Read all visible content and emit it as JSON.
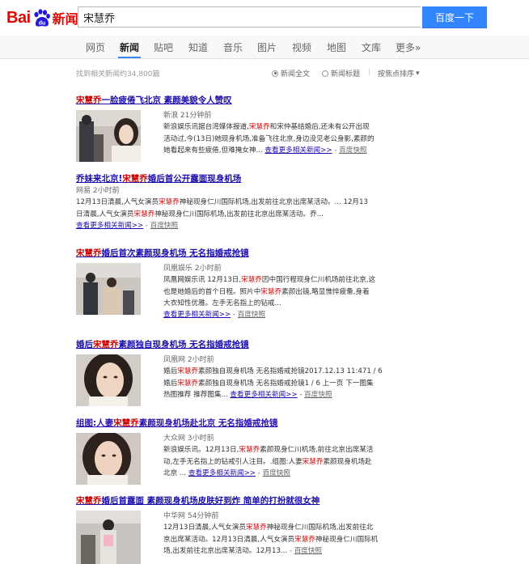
{
  "header": {
    "logo_bai": "Bai",
    "logo_du": "du",
    "logo_news": "新闻",
    "search_value": "宋慧乔",
    "search_button": "百度一下"
  },
  "tabs": [
    "网页",
    "新闻",
    "贴吧",
    "知道",
    "音乐",
    "图片",
    "视频",
    "地图",
    "文库",
    "更多»"
  ],
  "active_tab": "新闻",
  "infobar": {
    "count": "找到相关新闻约34,800篇",
    "opt_full": "新闻全文",
    "opt_title": "新闻标题",
    "sort": "按焦点排序",
    "sort_arrow": "▾"
  },
  "common": {
    "more": "查看更多相关新闻>>",
    "snapshot": "百度快照",
    "dash": "-"
  },
  "highlight": "宋慧乔",
  "results": [
    {
      "title_pre": "",
      "title_hl": "宋慧乔",
      "title_post": "一脸疲倦飞北京 素颜美貌令人赞叹",
      "source": "新浪  21分钟前",
      "lines": [
        [
          "新浪娱乐讯据台湾媒体报道,",
          "宋慧乔",
          "和宋仲基结婚后,还未有公开出现"
        ],
        [
          "活动过,今(13日)她现身机场,准备飞往北京,身边没见老公身影,素颜的",
          "",
          ""
        ],
        [
          "她看起来有些疲倦,但难掩女神...",
          "",
          ""
        ]
      ],
      "has_thumb": true
    },
    {
      "title_pre": "乔妹来北京!",
      "title_hl": "宋慧乔",
      "title_post": "婚后首公开露面现身机场",
      "source": "网易  2小时前",
      "lines": [
        [
          "12月13日清晨,人气女演员",
          "宋慧乔",
          "神秘现身仁川国际机场,出发前往北京出席某活动。... 12月13"
        ],
        [
          "日清晨,人气女演员",
          "宋慧乔",
          "神秘现身仁川国际机场,出发前往北京出席某活动。乔..."
        ]
      ],
      "has_thumb": false
    },
    {
      "title_pre": "",
      "title_hl": "宋慧乔",
      "title_post": "婚后首次素颜现身机场 无名指婚戒抢镜",
      "source": "凤凰娱乐  2小时前",
      "lines": [
        [
          "凤凰网娱乐讯 12月13日,",
          "宋慧乔",
          "因中国行程现身仁川机场前往北京,这"
        ],
        [
          "也是她婚后的首个日程。照片中",
          "宋慧乔",
          "素颜出镜,略显憔悴疲惫,身着"
        ],
        [
          "大衣知性优雅。左手无名指上的钻戒...",
          "",
          ""
        ]
      ],
      "has_thumb": true
    },
    {
      "title_pre": "婚后",
      "title_hl": "宋慧乔",
      "title_post": "素颜独自现身机场 无名指婚戒抢镜",
      "source": "凤凰网  2小时前",
      "lines": [
        [
          "婚后",
          "宋慧乔",
          "素颜独自现身机场 无名指婚戒抢镜2017.12.13 11:471 / 6"
        ],
        [
          "婚后",
          "宋慧乔",
          "素颜独自现身机场 无名指婚戒抢镜1 / 6 上一页 下一图集"
        ],
        [
          "热图推荐 推荐图集...",
          "",
          ""
        ]
      ],
      "has_thumb": true
    },
    {
      "title_pre": "组图:人妻",
      "title_hl": "宋慧乔",
      "title_post": "素颜现身机场赴北京 无名指婚戒抢镜",
      "source": "大众网  3小时前",
      "lines": [
        [
          "新浪娱乐讯。12月13日,",
          "宋慧乔",
          "素颜现身仁川机场,前往北京出席某活"
        ],
        [
          "动,左手无名指上的钻戒引人注目。.组图:人妻",
          "宋慧乔",
          "素颜现身机场赴"
        ],
        [
          "北京 ...",
          "",
          ""
        ]
      ],
      "has_thumb": true
    },
    {
      "title_pre": "",
      "title_hl": "宋慧乔",
      "title_post": "婚后首露面 素颜现身机场皮肤好到炸 简单的打扮就很女神",
      "source": "中华网  54分钟前",
      "lines": [
        [
          "12月13日清晨,人气女演员",
          "宋慧乔",
          "神秘现身仁川国际机场,出发前往北"
        ],
        [
          "京出席某活动。12月13日清晨,人气女演员",
          "宋慧乔",
          "神秘现身仁川国际机"
        ],
        [
          "场,出发前往北京出席某活动。12月13...",
          "",
          ""
        ]
      ],
      "has_thumb": true
    }
  ]
}
